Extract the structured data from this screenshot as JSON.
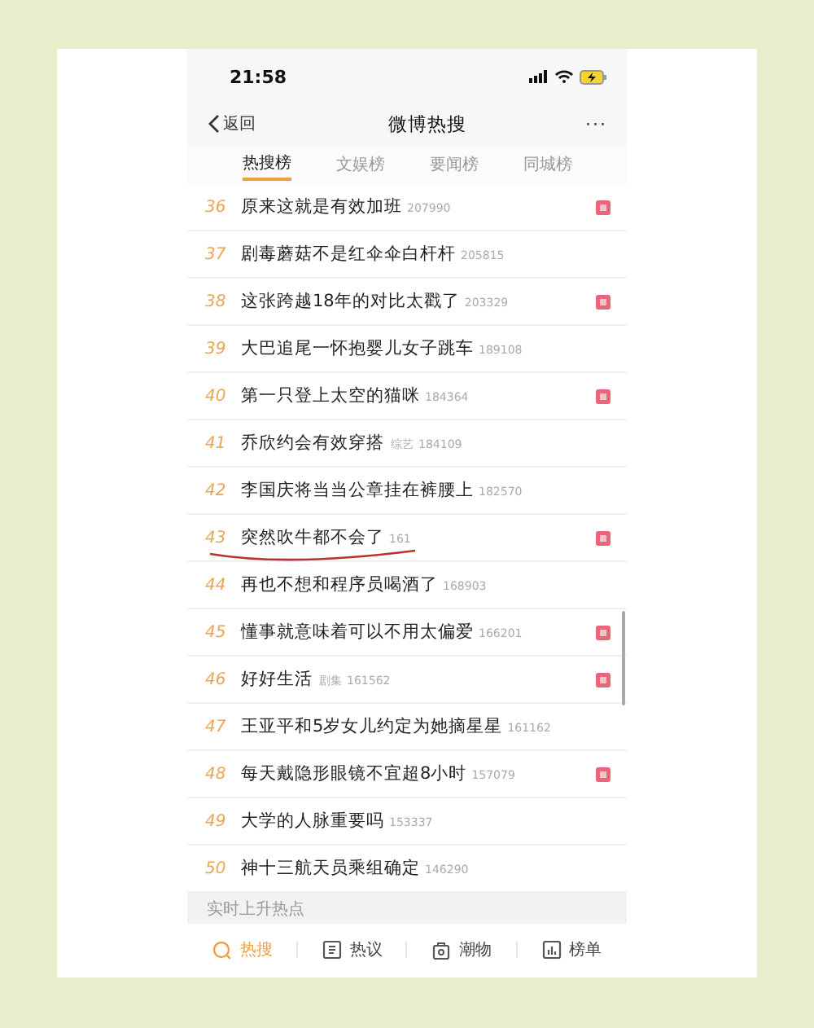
{
  "status_bar": {
    "time": "21:58"
  },
  "nav": {
    "back": "返回",
    "title": "微博热搜",
    "more": "···"
  },
  "tabs": [
    {
      "label": "热搜榜",
      "selected": true
    },
    {
      "label": "文娱榜",
      "selected": false
    },
    {
      "label": "要闻榜",
      "selected": false
    },
    {
      "label": "同城榜",
      "selected": false
    }
  ],
  "items": [
    {
      "rank": "36",
      "title": "原来这就是有效加班",
      "count": "207990",
      "new": true,
      "underlined": false
    },
    {
      "rank": "37",
      "title": "剧毒蘑菇不是红伞伞白杆杆",
      "count": "205815",
      "new": false,
      "underlined": false
    },
    {
      "rank": "38",
      "title": "这张跨越18年的对比太戳了",
      "count": "203329",
      "new": true,
      "underlined": false
    },
    {
      "rank": "39",
      "title": "大巴追尾一怀抱婴儿女子跳车",
      "count": "189108",
      "new": false,
      "underlined": false
    },
    {
      "rank": "40",
      "title": "第一只登上太空的猫咪",
      "count": "184364",
      "new": true,
      "underlined": false
    },
    {
      "rank": "41",
      "title": "乔欣约会有效穿搭",
      "tag": "综艺",
      "count": "184109",
      "new": false,
      "underlined": false
    },
    {
      "rank": "42",
      "title": "李国庆将当当公章挂在裤腰上",
      "count": "182570",
      "new": false,
      "underlined": false
    },
    {
      "rank": "43",
      "title": "突然吹牛都不会了",
      "count": "161",
      "new": true,
      "underlined": true
    },
    {
      "rank": "44",
      "title": "再也不想和程序员喝酒了",
      "count": "168903",
      "new": false,
      "underlined": false
    },
    {
      "rank": "45",
      "title": "懂事就意味着可以不用太偏爱",
      "count": "166201",
      "new": true,
      "underlined": false
    },
    {
      "rank": "46",
      "title": "好好生活",
      "tag": "剧集",
      "count": "161562",
      "new": true,
      "underlined": false
    },
    {
      "rank": "47",
      "title": "王亚平和5岁女儿约定为她摘星星",
      "count": "161162",
      "new": false,
      "underlined": false
    },
    {
      "rank": "48",
      "title": "每天戴隐形眼镜不宜超8小时",
      "count": "157079",
      "new": true,
      "underlined": false
    },
    {
      "rank": "49",
      "title": "大学的人脉重要吗",
      "count": "153337",
      "new": false,
      "underlined": false
    },
    {
      "rank": "50",
      "title": "神十三航天员乘组确定",
      "count": "146290",
      "new": false,
      "underlined": false
    }
  ],
  "section_label": "实时上升热点",
  "bottom_tabs": [
    {
      "label": "热搜",
      "kind": "search",
      "selected": true
    },
    {
      "label": "热议",
      "kind": "doc",
      "selected": false
    },
    {
      "label": "潮物",
      "kind": "bag",
      "selected": false
    },
    {
      "label": "榜单",
      "kind": "chart",
      "selected": false
    }
  ]
}
